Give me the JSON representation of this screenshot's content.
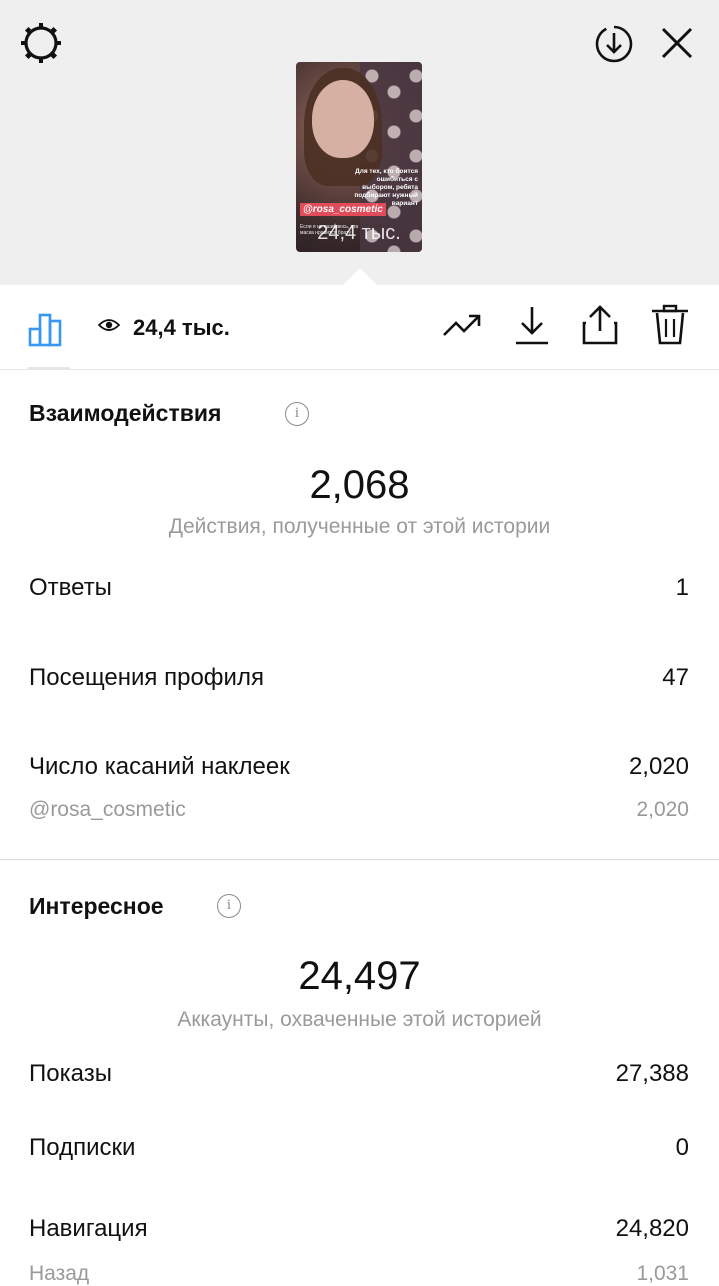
{
  "story": {
    "overlay_caption": "Для тех, кто боится ошибиться с выбором, ребята подбирают нужный вариант",
    "mention_tag": "@rosa_cosmetic",
    "views_overlay": "24,4 тыс.",
    "small_caption": "Если я не ошибаюсь, эта маска нравится брату"
  },
  "toolbar": {
    "views": "24,4 тыс."
  },
  "engagement": {
    "title": "Взаимодействия",
    "total": "2,068",
    "subtitle": "Действия, полученные от этой истории",
    "rows": [
      {
        "label": "Ответы",
        "value": "1"
      },
      {
        "label": "Посещения профиля",
        "value": "47"
      },
      {
        "label": "Число касаний наклеек",
        "value": "2,020"
      }
    ],
    "sub_row": {
      "label": "@rosa_cosmetic",
      "value": "2,020"
    }
  },
  "discovery": {
    "title": "Интересное",
    "total": "24,497",
    "subtitle": "Аккаунты, охваченные этой историей",
    "rows": [
      {
        "label": "Показы",
        "value": "27,388"
      },
      {
        "label": "Подписки",
        "value": "0"
      },
      {
        "label": "Навигация",
        "value": "24,820"
      }
    ],
    "sub_row": {
      "label": "Назад",
      "value": "1,031"
    }
  },
  "icons": {
    "settings": "gear-icon",
    "save": "download-circle-icon",
    "close": "close-icon",
    "insights": "bar-chart-icon",
    "views": "eye-icon",
    "promote": "trending-up-icon",
    "download": "download-icon",
    "share": "share-icon",
    "delete": "trash-icon"
  },
  "colors": {
    "accent": "#3897f0",
    "tag": "#e14b5a",
    "muted": "#9a9a9a"
  }
}
